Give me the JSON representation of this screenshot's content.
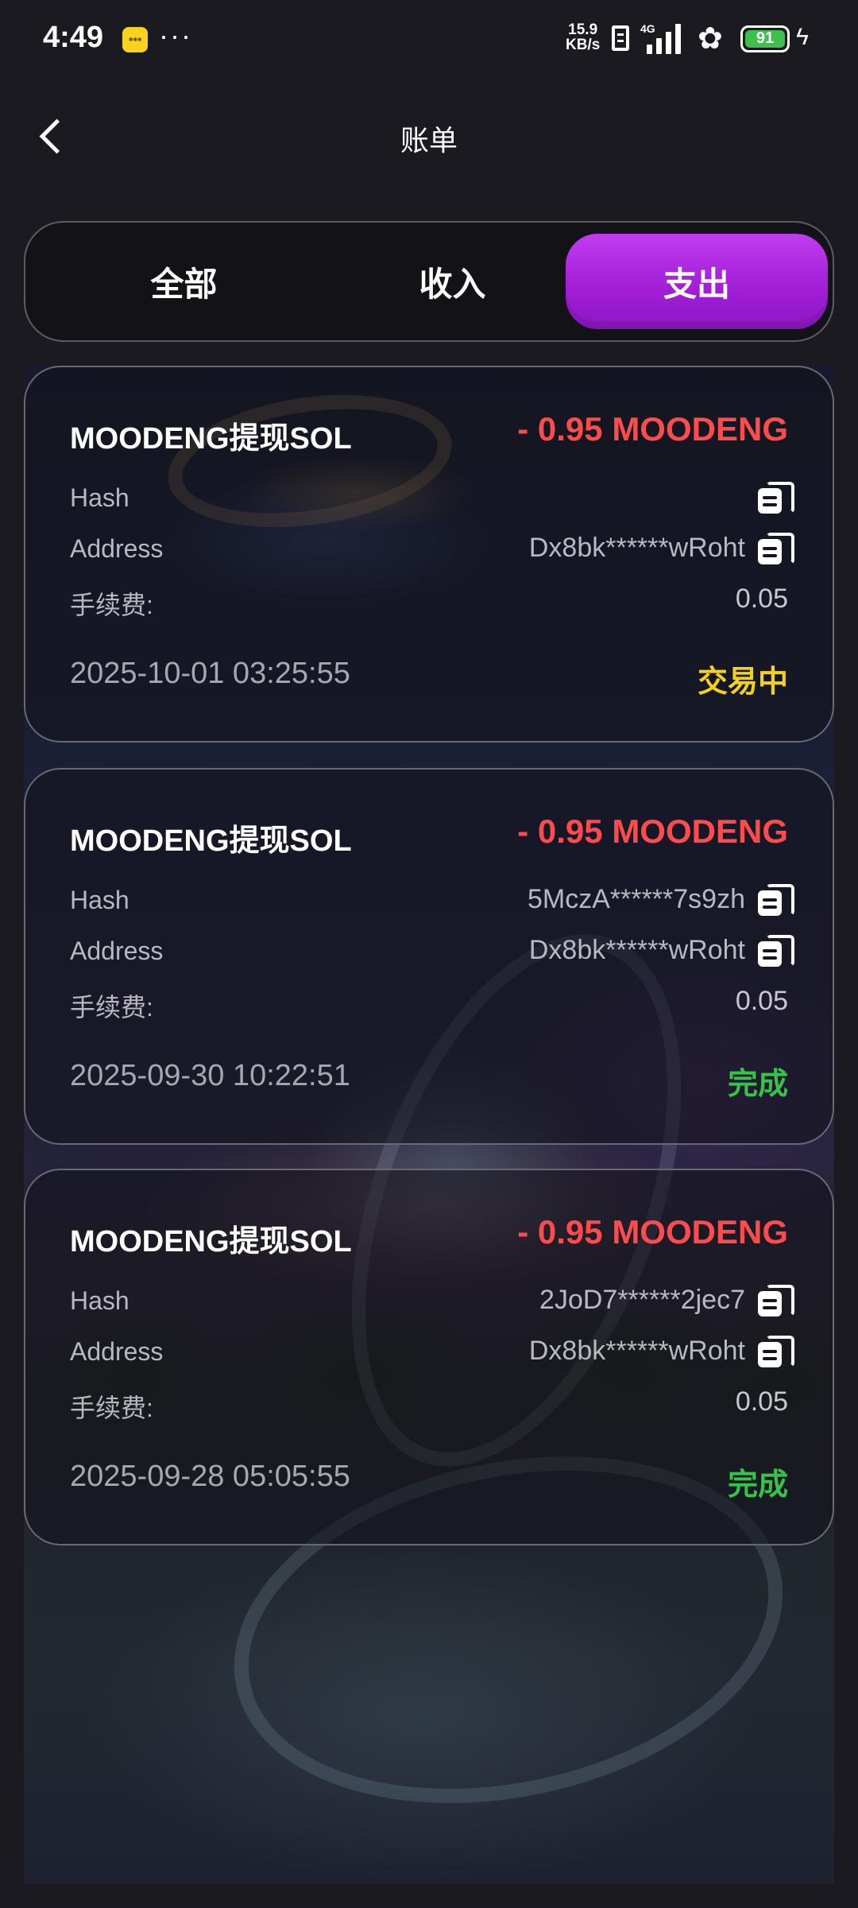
{
  "status_bar": {
    "time": "4:49",
    "speed_top": "15.9",
    "speed_bottom": "KB/s",
    "network": "4G",
    "battery": "91",
    "more": "···"
  },
  "header": {
    "title": "账单"
  },
  "tabs": [
    {
      "label": "全部",
      "active": false
    },
    {
      "label": "收入",
      "active": false
    },
    {
      "label": "支出",
      "active": true
    }
  ],
  "labels": {
    "hash": "Hash",
    "address": "Address",
    "fee": "手续费:"
  },
  "records": [
    {
      "title": "MOODENG提现SOL",
      "amount": "- 0.95 MOODENG",
      "hash": "",
      "address": "Dx8bk******wRoht",
      "fee": "0.05",
      "datetime": "2025-10-01 03:25:55",
      "status": "交易中",
      "status_color": "#f5d21a"
    },
    {
      "title": "MOODENG提现SOL",
      "amount": "- 0.95 MOODENG",
      "hash": "5MczA******7s9zh",
      "address": "Dx8bk******wRoht",
      "fee": "0.05",
      "datetime": "2025-09-30 10:22:51",
      "status": "完成",
      "status_color": "#39c24a"
    },
    {
      "title": "MOODENG提现SOL",
      "amount": "- 0.95 MOODENG",
      "hash": "2JoD7******2jec7",
      "address": "Dx8bk******wRoht",
      "fee": "0.05",
      "datetime": "2025-09-28 05:05:55",
      "status": "完成",
      "status_color": "#39c24a"
    }
  ],
  "colors": {
    "accent": "#a31fd8",
    "amount": "#ff4b4b",
    "pending": "#f5d21a",
    "done": "#39c24a"
  }
}
